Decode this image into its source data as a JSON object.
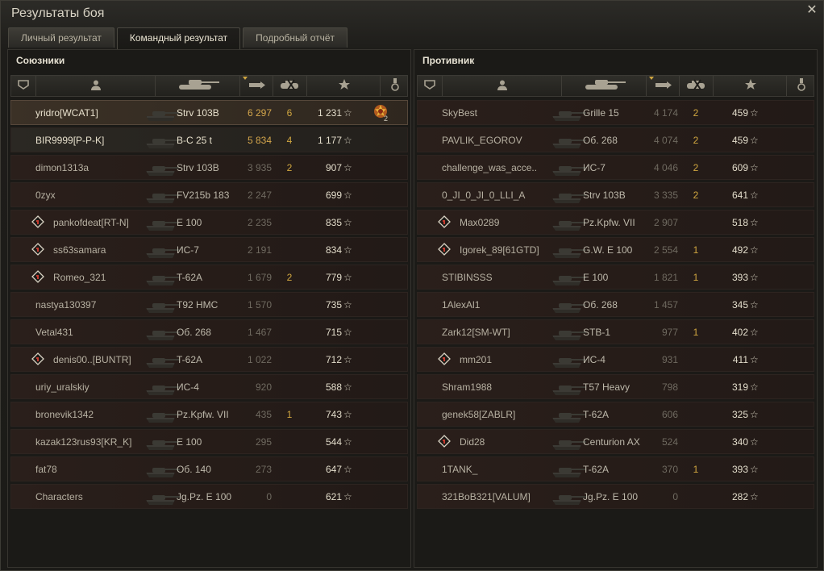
{
  "window": {
    "title": "Результаты боя",
    "close_glyph": "✕"
  },
  "tabs": [
    {
      "label": "Личный результат",
      "active": false
    },
    {
      "label": "Командный результат",
      "active": true
    },
    {
      "label": "Подробный отчёт",
      "active": false
    }
  ],
  "columns": {
    "icons": [
      "squad-icon",
      "player-icon",
      "tank-icon",
      "damage-icon",
      "frags-icon",
      "xp-star-icon",
      "medal-icon"
    ],
    "sorted_column": "damage"
  },
  "star_glyph": "☆",
  "allies": {
    "title": "Союзники",
    "rows": [
      {
        "name": "yridro[WCAT1]",
        "vehicle": "Strv 103B",
        "damage": "6 297",
        "kills": "6",
        "xp": "1 231",
        "highlight": true,
        "medal": true,
        "medal_count": "2"
      },
      {
        "name": "BIR9999[P-P-K]",
        "vehicle": "B-C 25 t",
        "damage": "5 834",
        "kills": "4",
        "xp": "1 177",
        "bright": true
      },
      {
        "name": "dimon1313a",
        "vehicle": "Strv 103B",
        "damage": "3 935",
        "kills": "2",
        "xp": "907"
      },
      {
        "name": "0zyx",
        "vehicle": "FV215b 183",
        "damage": "2 247",
        "kills": "",
        "xp": "699"
      },
      {
        "name": "pankofdeat[RT-N]",
        "vehicle": "E 100",
        "damage": "2 235",
        "kills": "",
        "xp": "835",
        "platoon": true
      },
      {
        "name": "ss63samara",
        "vehicle": "ИС-7",
        "damage": "2 191",
        "kills": "",
        "xp": "834",
        "platoon": true
      },
      {
        "name": "Romeo_321",
        "vehicle": "T-62A",
        "damage": "1 679",
        "kills": "2",
        "xp": "779",
        "platoon": true
      },
      {
        "name": "nastya130397",
        "vehicle": "T92 HMC",
        "damage": "1 570",
        "kills": "",
        "xp": "735"
      },
      {
        "name": "Vetal431",
        "vehicle": "Об. 268",
        "damage": "1 467",
        "kills": "",
        "xp": "715"
      },
      {
        "name": "denis00..[BUNTR]",
        "vehicle": "T-62A",
        "damage": "1 022",
        "kills": "",
        "xp": "712",
        "platoon": true
      },
      {
        "name": "uriy_uralskiy",
        "vehicle": "ИС-4",
        "damage": "920",
        "kills": "",
        "xp": "588"
      },
      {
        "name": "bronevik1342",
        "vehicle": "Pz.Kpfw. VII",
        "damage": "435",
        "kills": "1",
        "xp": "743"
      },
      {
        "name": "kazak123rus93[KR_K]",
        "vehicle": "E 100",
        "damage": "295",
        "kills": "",
        "xp": "544"
      },
      {
        "name": "fat78",
        "vehicle": "Об. 140",
        "damage": "273",
        "kills": "",
        "xp": "647"
      },
      {
        "name": "Characters",
        "vehicle": "Jg.Pz. E 100",
        "damage": "0",
        "kills": "",
        "xp": "621"
      }
    ]
  },
  "enemies": {
    "title": "Противник",
    "rows": [
      {
        "name": "SkyBest",
        "vehicle": "Grille 15",
        "damage": "4 174",
        "kills": "2",
        "xp": "459"
      },
      {
        "name": "PAVLIK_EGOROV",
        "vehicle": "Об. 268",
        "damage": "4 074",
        "kills": "2",
        "xp": "459"
      },
      {
        "name": "challenge_was_acce..",
        "vehicle": "ИС-7",
        "damage": "4 046",
        "kills": "2",
        "xp": "609"
      },
      {
        "name": "0_JI_0_JI_0_LLI_A",
        "vehicle": "Strv 103B",
        "damage": "3 335",
        "kills": "2",
        "xp": "641"
      },
      {
        "name": "Max0289",
        "vehicle": "Pz.Kpfw. VII",
        "damage": "2 907",
        "kills": "",
        "xp": "518",
        "platoon": true
      },
      {
        "name": "Igorek_89[61GTD]",
        "vehicle": "G.W. E 100",
        "damage": "2 554",
        "kills": "1",
        "xp": "492",
        "platoon": true
      },
      {
        "name": "STIBINSSS",
        "vehicle": "E 100",
        "damage": "1 821",
        "kills": "1",
        "xp": "393"
      },
      {
        "name": "1AlexAl1",
        "vehicle": "Об. 268",
        "damage": "1 457",
        "kills": "",
        "xp": "345"
      },
      {
        "name": "Zark12[SM-WT]",
        "vehicle": "STB-1",
        "damage": "977",
        "kills": "1",
        "xp": "402"
      },
      {
        "name": "mm201",
        "vehicle": "ИС-4",
        "damage": "931",
        "kills": "",
        "xp": "411",
        "platoon": true
      },
      {
        "name": "Shram1988",
        "vehicle": "T57 Heavy",
        "damage": "798",
        "kills": "",
        "xp": "319"
      },
      {
        "name": "genek58[ZABLR]",
        "vehicle": "T-62A",
        "damage": "606",
        "kills": "",
        "xp": "325"
      },
      {
        "name": "Did28",
        "vehicle": "Centurion AX",
        "damage": "524",
        "kills": "",
        "xp": "340",
        "platoon": true
      },
      {
        "name": "1TANK_",
        "vehicle": "T-62A",
        "damage": "370",
        "kills": "1",
        "xp": "393"
      },
      {
        "name": "321BoB321[VALUM]",
        "vehicle": "Jg.Pz. E 100",
        "damage": "0",
        "kills": "",
        "xp": "282"
      }
    ]
  }
}
